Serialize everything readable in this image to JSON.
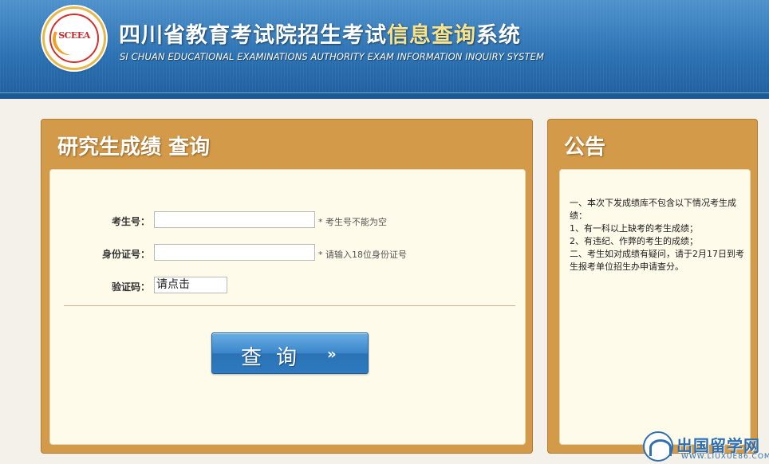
{
  "header": {
    "logo_text": "SCEEA",
    "title_part1": "四川省教育考试院招生考试",
    "title_highlight": "信息查询",
    "title_part2": "系统",
    "title_en": "SI CHUAN EDUCATIONAL EXAMINATIONS AUTHORITY EXAM INFORMATION INQUIRY SYSTEM"
  },
  "query_panel": {
    "title": "研究生成绩  查询",
    "fields": {
      "exam_no_label": "考生号：",
      "exam_no_value": "",
      "exam_no_hint": "* 考生号不能为空",
      "id_label": "身份证号：",
      "id_value": "",
      "id_hint": "* 请输入18位身份证号",
      "captcha_label": "验证码：",
      "captcha_text": "请点击"
    },
    "submit_label": "查询",
    "submit_arrows": "»"
  },
  "notice_panel": {
    "title": "公告",
    "lines": [
      "一、本次下发成绩库不包含以下情况考生成绩：",
      "1、有一科以上缺考的考生成绩；",
      "2、有违纪、作弊的考生的成绩；",
      "二、考生如对成绩有疑问，请于2月17日到考生报考单位招生办申请查分。"
    ]
  },
  "watermark": {
    "main": "出国留学网",
    "sub": "WWW.LIUXUE86.COM"
  },
  "colors": {
    "header_blue": "#2d72b3",
    "title_highlight": "#fbe38a",
    "panel_orange": "#d39b49",
    "panel_inner": "#fffbea",
    "button_blue": "#3a86cb"
  }
}
